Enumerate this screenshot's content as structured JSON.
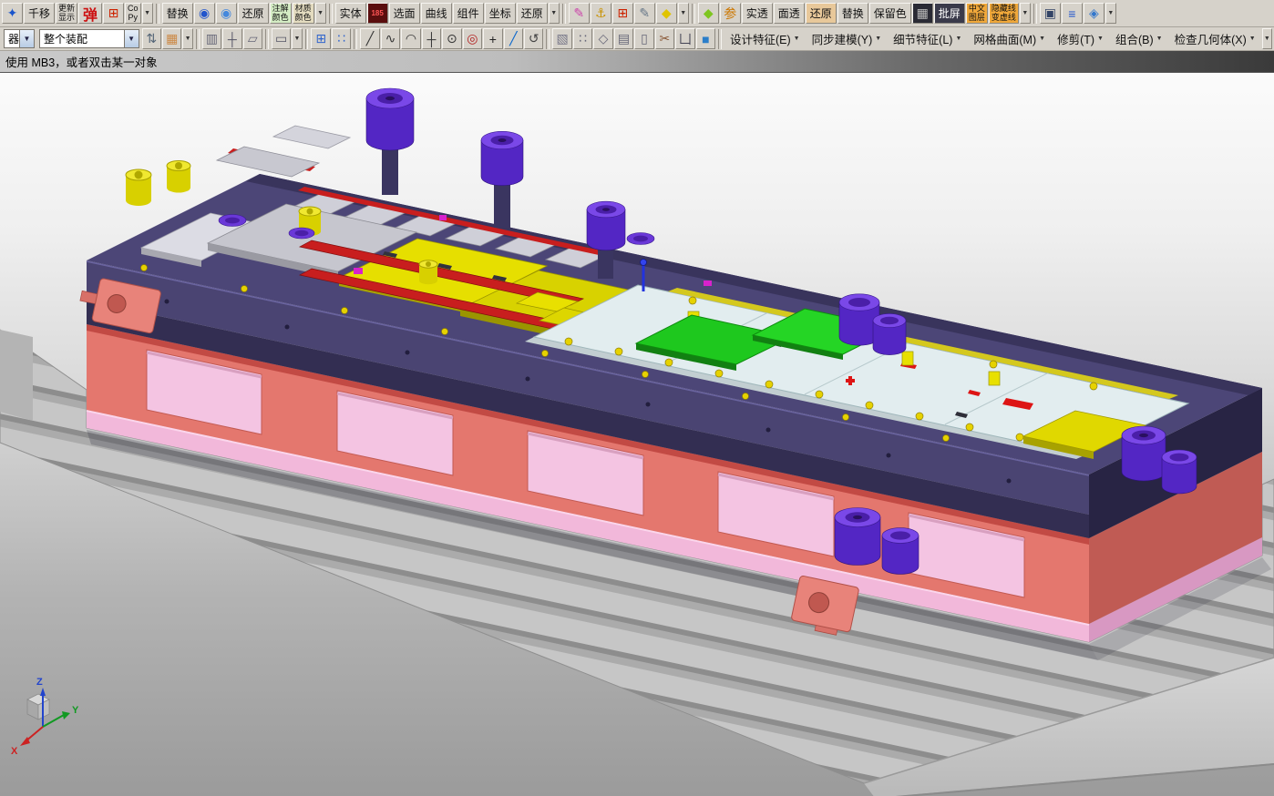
{
  "ui": {
    "dropdown_glyph": "▼"
  },
  "toolbar_row1": {
    "items": [
      {
        "k": "icon",
        "name": "app-icon",
        "g": "✦",
        "c": "#1a55cc"
      },
      {
        "k": "btn",
        "name": "pan-move-button",
        "label": "千移"
      },
      {
        "k": "btn2",
        "name": "update-display-button",
        "l1": "更新",
        "l2": "显示"
      },
      {
        "k": "btn",
        "name": "pop-button",
        "label": "弹",
        "cls": "big",
        "c": "#cc1111"
      },
      {
        "k": "icon",
        "name": "red-grid-icon",
        "g": "⊞",
        "c": "#cc2200"
      },
      {
        "k": "btn2",
        "name": "copy-button",
        "l1": "Co",
        "l2": "Py"
      },
      {
        "k": "dd",
        "name": "clipboard-dropdown-arrow"
      },
      {
        "k": "sep"
      },
      {
        "k": "btn",
        "name": "replace-button-1",
        "label": "替换"
      },
      {
        "k": "icon",
        "name": "blue-sphere-icon",
        "g": "◉",
        "c": "#2255cc"
      },
      {
        "k": "icon",
        "name": "blue-sphere2-icon",
        "g": "◉",
        "c": "#4488dd"
      },
      {
        "k": "btn",
        "name": "restore-button-1",
        "label": "还原"
      },
      {
        "k": "btn2",
        "name": "annotation-color-button",
        "l1": "注解",
        "l2": "颜色",
        "bg": "#d4ecc4"
      },
      {
        "k": "btn2",
        "name": "material-color-button",
        "l1": "材质",
        "l2": "颜色",
        "bg": "#e4dcc0"
      },
      {
        "k": "dd",
        "name": "color-dropdown-arrow"
      },
      {
        "k": "sep"
      },
      {
        "k": "btn",
        "name": "solid-button",
        "label": "实体"
      },
      {
        "k": "icon",
        "name": "display-185-icon",
        "g": "185",
        "c": "#ff5555",
        "bg": "#5a0e0e",
        "cls": "digits"
      },
      {
        "k": "btn",
        "name": "select-face-button",
        "label": "选面"
      },
      {
        "k": "btn",
        "name": "curve-button",
        "label": "曲线"
      },
      {
        "k": "btn",
        "name": "component-button",
        "label": "组件"
      },
      {
        "k": "btn",
        "name": "coordinate-button",
        "label": "坐标"
      },
      {
        "k": "btn",
        "name": "restore-button-2",
        "label": "还原"
      },
      {
        "k": "dd",
        "name": "selection-dropdown-arrow"
      },
      {
        "k": "sep"
      },
      {
        "k": "icon",
        "name": "pencil-pin-icon",
        "g": "✎",
        "c": "#cc44aa"
      },
      {
        "k": "icon",
        "name": "anchor-lock-icon",
        "g": "⚓",
        "c": "#c89200"
      },
      {
        "k": "icon",
        "name": "red-grid2-icon",
        "g": "⊞",
        "c": "#cc2200"
      },
      {
        "k": "icon",
        "name": "gear-edit-icon",
        "g": "✎",
        "c": "#667788"
      },
      {
        "k": "icon",
        "name": "yellow-diamond-icon",
        "g": "◆",
        "c": "#e0c400"
      },
      {
        "k": "dd",
        "name": "tools-dropdown-arrow"
      },
      {
        "k": "sep"
      },
      {
        "k": "icon",
        "name": "green-diamond-icon",
        "g": "◆",
        "c": "#7ec520"
      },
      {
        "k": "icon",
        "name": "param-diamond-icon",
        "g": "参",
        "c": "#cc7700"
      },
      {
        "k": "btn",
        "name": "solid-translucent-button",
        "label": "实透"
      },
      {
        "k": "btn",
        "name": "face-translucent-button",
        "label": "面透"
      },
      {
        "k": "btn",
        "name": "restore-button-3",
        "label": "还原",
        "bg": "#e8c89a"
      },
      {
        "k": "btn",
        "name": "replace-button-2",
        "label": "替换"
      },
      {
        "k": "btn",
        "name": "keep-color-button",
        "label": "保留色"
      },
      {
        "k": "icon",
        "name": "render-preview-icon",
        "g": "▦",
        "c": "#bbbbbb",
        "bg": "#2a2a34"
      },
      {
        "k": "btn",
        "name": "batch-screen-button",
        "label": "批屏",
        "bg": "#3a3a4a",
        "c": "#ffffff"
      },
      {
        "k": "btn2",
        "name": "chinese-layer-button",
        "l1": "中文",
        "l2": "图层",
        "bg": "#f0a83a"
      },
      {
        "k": "btn2",
        "name": "hidden-line-button",
        "l1": "隐藏线",
        "l2": "变虚线",
        "bg": "#f0a83a"
      },
      {
        "k": "dd",
        "name": "display-dropdown-arrow"
      },
      {
        "k": "sep"
      },
      {
        "k": "icon",
        "name": "monitor-icon",
        "g": "▣",
        "c": "#334466"
      },
      {
        "k": "icon",
        "name": "blue-lines-icon",
        "g": "≡",
        "c": "#2255cc"
      },
      {
        "k": "icon",
        "name": "help-icon",
        "g": "◈",
        "c": "#3377cc"
      },
      {
        "k": "dd",
        "name": "help-dropdown-arrow"
      }
    ]
  },
  "toolbar_row2": {
    "items": [
      {
        "k": "combo",
        "name": "type-filter-combo",
        "value": "器",
        "w": 34
      },
      {
        "k": "combo",
        "name": "selection-scope-combo",
        "value": "整个装配",
        "w": 118
      },
      {
        "k": "icon",
        "name": "link-icon",
        "g": "⇅",
        "c": "#556677"
      },
      {
        "k": "icon",
        "name": "palette-icon",
        "g": "▦",
        "c": "#cc8844"
      },
      {
        "k": "dd",
        "name": "scope-dropdown-arrow"
      },
      {
        "k": "sep"
      },
      {
        "k": "icon",
        "name": "isometric-cube-icon",
        "g": "▥",
        "c": "#666677"
      },
      {
        "k": "icon",
        "name": "orient-icon",
        "g": "┼",
        "c": "#555566"
      },
      {
        "k": "icon",
        "name": "datum-plane-icon",
        "g": "▱",
        "c": "#666677"
      },
      {
        "k": "sep"
      },
      {
        "k": "icon",
        "name": "rect-select-icon",
        "g": "▭",
        "c": "#555566"
      },
      {
        "k": "dd",
        "name": "select-mode-dropdown-arrow"
      },
      {
        "k": "sep"
      },
      {
        "k": "icon",
        "name": "grid-icon",
        "g": "⊞",
        "c": "#3366cc"
      },
      {
        "k": "icon",
        "name": "snap-points-icon",
        "g": "∷",
        "c": "#3366cc"
      },
      {
        "k": "sep"
      },
      {
        "k": "icon",
        "name": "line-tool-icon",
        "g": "╱",
        "c": "#333333"
      },
      {
        "k": "icon",
        "name": "spline-tool-icon",
        "g": "∿",
        "c": "#333333"
      },
      {
        "k": "icon",
        "name": "arc-tool-icon",
        "g": "◠",
        "c": "#333333"
      },
      {
        "k": "icon",
        "name": "point-tool-icon",
        "g": "┼",
        "c": "#333333"
      },
      {
        "k": "icon",
        "name": "circle-center-icon",
        "g": "⊙",
        "c": "#333333"
      },
      {
        "k": "icon",
        "name": "circle-tool-icon",
        "g": "◎",
        "c": "#b32222"
      },
      {
        "k": "icon",
        "name": "plus-tool-icon",
        "g": "+",
        "c": "#222222"
      },
      {
        "k": "icon",
        "name": "angle-line-icon",
        "g": "╱",
        "c": "#0866cc"
      },
      {
        "k": "icon",
        "name": "rotate-arc-icon",
        "g": "↺",
        "c": "#444444"
      },
      {
        "k": "sep"
      },
      {
        "k": "icon",
        "name": "trim-body-icon",
        "g": "▧",
        "c": "#777788"
      },
      {
        "k": "icon",
        "name": "pattern-icon",
        "g": "∷",
        "c": "#666677"
      },
      {
        "k": "icon",
        "name": "mirror-icon",
        "g": "◇",
        "c": "#666677"
      },
      {
        "k": "icon",
        "name": "sheet-icon",
        "g": "▤",
        "c": "#666677"
      },
      {
        "k": "icon",
        "name": "measure-icon",
        "g": "▯",
        "c": "#666677"
      },
      {
        "k": "icon",
        "name": "scissors-icon",
        "g": "✂",
        "c": "#885533"
      },
      {
        "k": "icon",
        "name": "slot-icon",
        "g": "凵",
        "c": "#444455"
      },
      {
        "k": "icon",
        "name": "blue-box-icon",
        "g": "■",
        "c": "#2b7ec9"
      },
      {
        "k": "sep"
      },
      {
        "k": "menu",
        "name": "menu-design-feature",
        "label": "设计特征(E)"
      },
      {
        "k": "menu",
        "name": "menu-synchronous-modeling",
        "label": "同步建模(Y)"
      },
      {
        "k": "menu",
        "name": "menu-detail-feature",
        "label": "细节特征(L)"
      },
      {
        "k": "menu",
        "name": "menu-mesh-surface",
        "label": "网格曲面(M)"
      },
      {
        "k": "menu",
        "name": "menu-trim",
        "label": "修剪(T)"
      },
      {
        "k": "menu",
        "name": "menu-combine",
        "label": "组合(B)"
      },
      {
        "k": "menu",
        "name": "menu-check-geometry",
        "label": "检查几何体(X)"
      },
      {
        "k": "dd",
        "name": "menu-overflow-arrow"
      }
    ]
  },
  "prompt_bar": {
    "message": "使用 MB3，或者双击某一对象"
  },
  "viewport": {
    "triad": {
      "x": "X",
      "y": "Y",
      "z": "Z"
    }
  }
}
